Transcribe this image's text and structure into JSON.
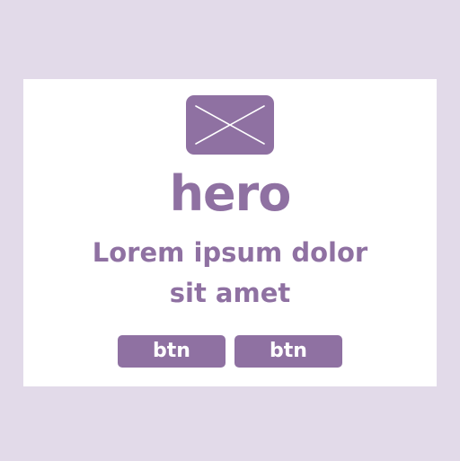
{
  "colors": {
    "background": "#e2dae9",
    "card": "#ffffff",
    "accent": "#8f71a2"
  },
  "hero": {
    "image_icon": "image-placeholder-icon",
    "title": "hero",
    "subtitle_line1": "Lorem ipsum dolor",
    "subtitle_line2": "sit amet"
  },
  "buttons": {
    "primary_label": "btn",
    "secondary_label": "btn"
  }
}
